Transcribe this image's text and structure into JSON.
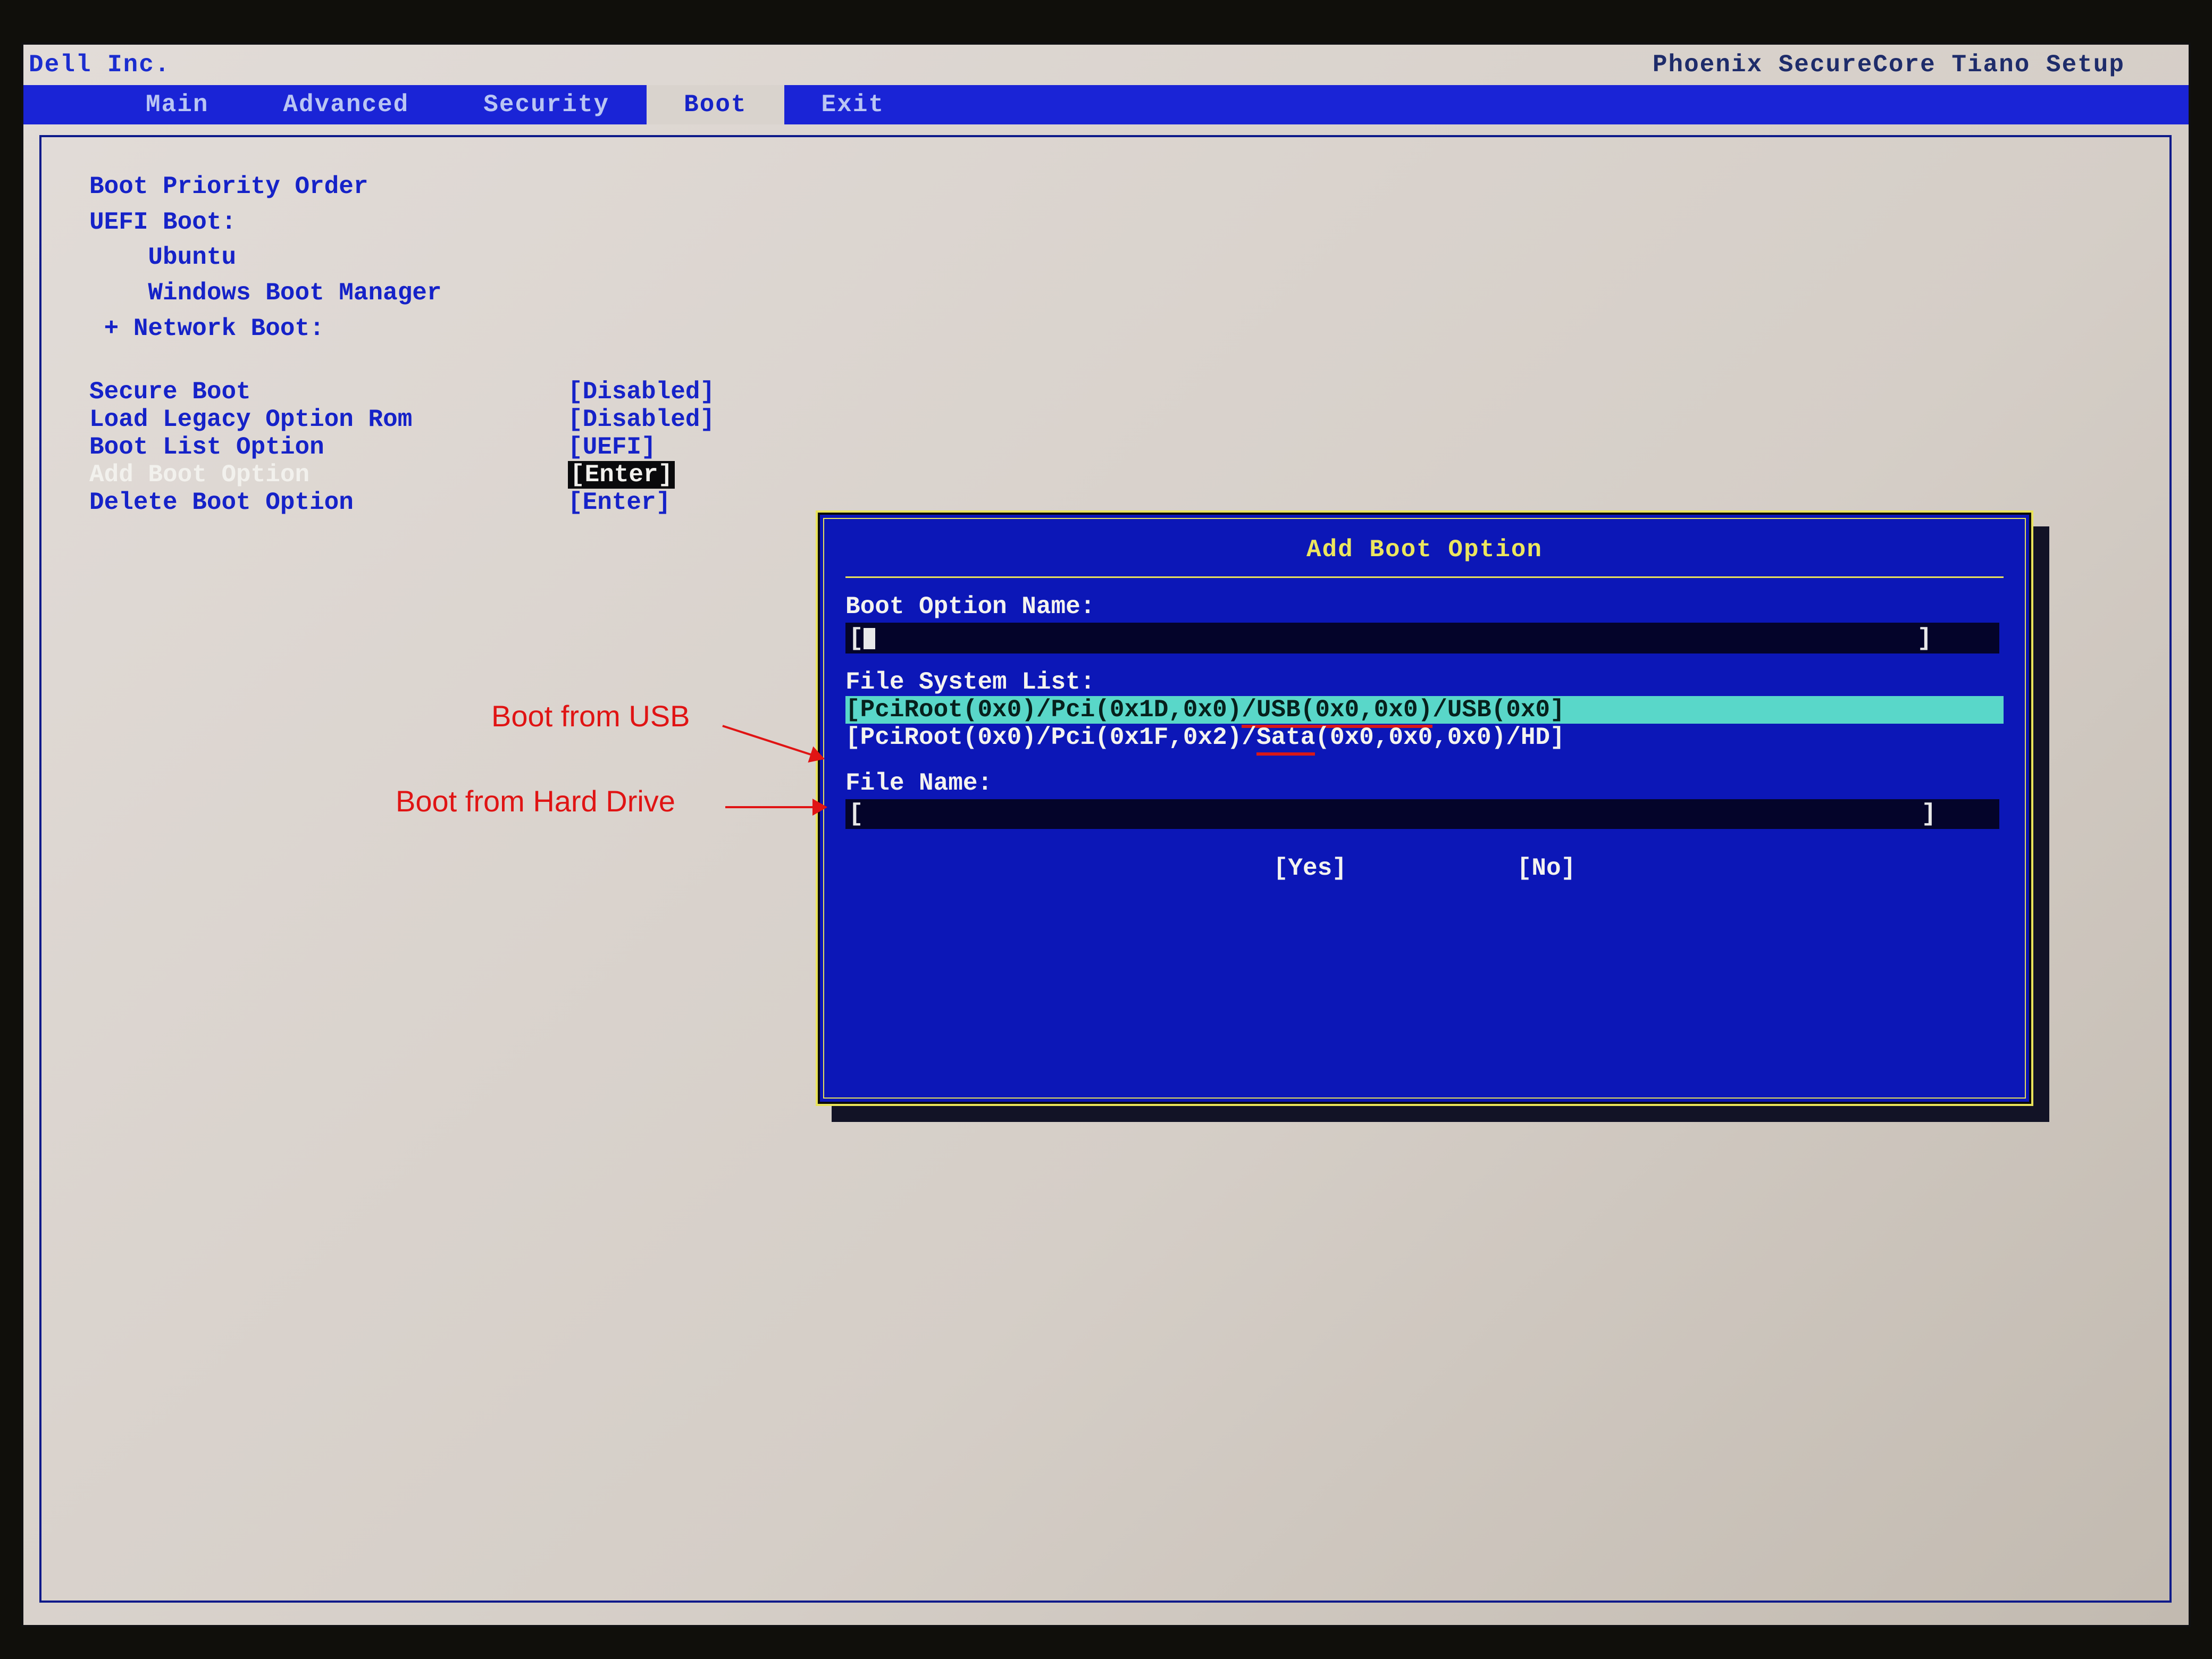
{
  "header": {
    "vendor": "Dell Inc.",
    "product": "Phoenix SecureCore Tiano Setup"
  },
  "menu": {
    "items": [
      "Main",
      "Advanced",
      "Security",
      "Boot",
      "Exit"
    ],
    "active_index": 3
  },
  "boot_page": {
    "title": "Boot Priority Order",
    "uefi_heading": "UEFI Boot:",
    "uefi_items": [
      "Ubuntu",
      "Windows Boot Manager"
    ],
    "network_heading": "+ Network Boot:",
    "options": [
      {
        "label": "Secure Boot",
        "value": "[Disabled]",
        "selected": false
      },
      {
        "label": "Load Legacy Option Rom",
        "value": "[Disabled]",
        "selected": false
      },
      {
        "label": "Boot List Option",
        "value": "[UEFI]",
        "selected": false
      },
      {
        "label": "Add Boot Option",
        "value": "[Enter]",
        "selected": true
      },
      {
        "label": "Delete Boot Option",
        "value": "[Enter]",
        "selected": false
      }
    ]
  },
  "dialog": {
    "title": "Add Boot Option",
    "name_label": "Boot Option Name:",
    "name_value": "",
    "fs_label": "File System List:",
    "fs_items": [
      {
        "text_before_red": "[PciRoot(0x0)/Pci(0x1D,0x0)",
        "red": "/USB(0x0,0x0)",
        "text_after_red": "/USB(0x0]",
        "selected": true
      },
      {
        "text_before_red": "[PciRoot(0x0)/Pci(0x1F,0x2)/",
        "red": "Sata",
        "text_after_red": "(0x0,0x0,0x0)/HD]",
        "selected": false
      }
    ],
    "file_label": "File Name:",
    "file_value": "",
    "yes": "[Yes]",
    "no": "[No]"
  },
  "annotations": {
    "usb": "Boot from USB",
    "hdd": "Boot from Hard Drive"
  }
}
